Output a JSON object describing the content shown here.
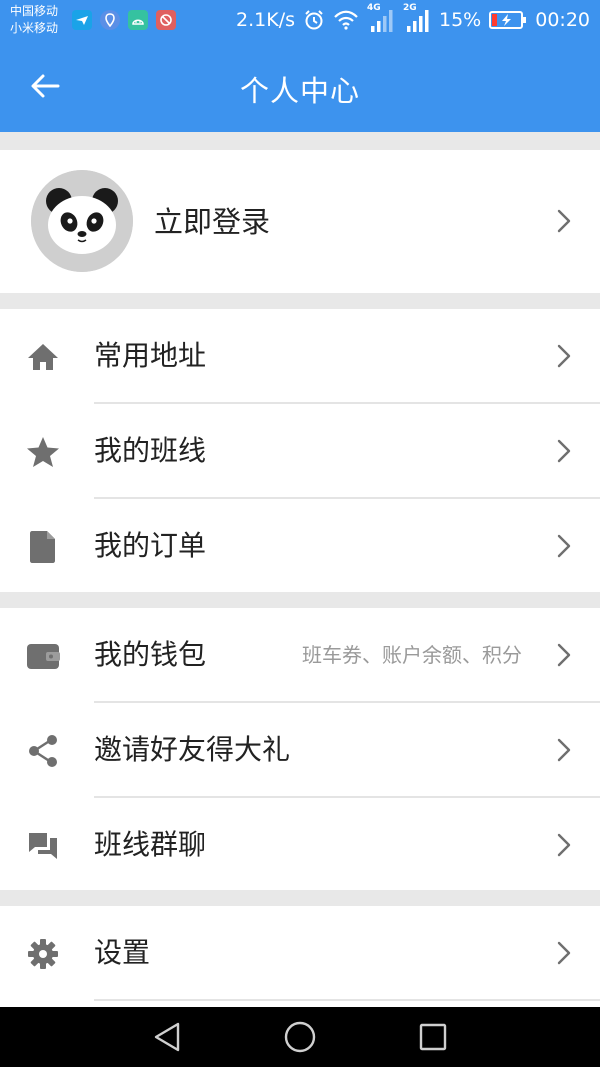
{
  "status_bar": {
    "carrier_1": "中国移动",
    "carrier_2": "小米移动",
    "net_speed": "2.1K/s",
    "sim1_label": "4G",
    "sim2_label": "2G",
    "battery_percent": "15%",
    "time": "00:20",
    "app_icons": [
      "tt-bird-icon",
      "location-pin-icon",
      "android-icon",
      "blocked-app-icon"
    ]
  },
  "header": {
    "title": "个人中心",
    "back_icon": "arrow-left-icon"
  },
  "profile": {
    "login_label": "立即登录",
    "avatar_icon": "panda-avatar-icon"
  },
  "menu_groups": [
    {
      "items": [
        {
          "label": "常用地址",
          "icon": "home-icon"
        },
        {
          "label": "我的班线",
          "icon": "star-icon"
        },
        {
          "label": "我的订单",
          "icon": "document-icon"
        }
      ]
    },
    {
      "items": [
        {
          "label": "我的钱包",
          "icon": "wallet-icon",
          "description": "班车券、账户余额、积分"
        },
        {
          "label": "邀请好友得大礼",
          "icon": "share-icon"
        },
        {
          "label": "班线群聊",
          "icon": "chat-icon"
        }
      ]
    },
    {
      "items": [
        {
          "label": "设置",
          "icon": "gear-icon"
        }
      ]
    }
  ],
  "nav_bar": {
    "buttons": [
      "back-triangle-icon",
      "home-circle-icon",
      "recents-square-icon"
    ]
  },
  "colors": {
    "primary": "#3d93ee",
    "text": "#222222",
    "secondary_text": "#9a9a9a",
    "icon": "#6f6f6f",
    "background": "#e8e8e8"
  }
}
